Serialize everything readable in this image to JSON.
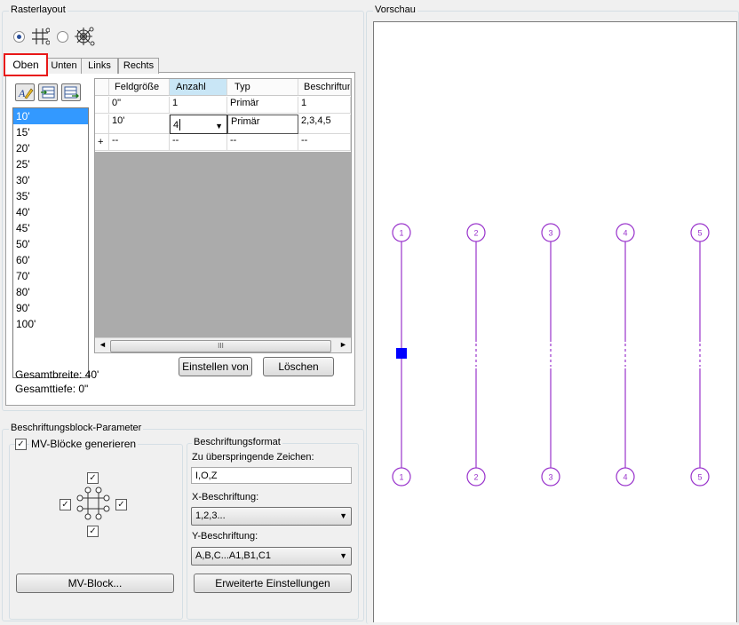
{
  "raster_layout": {
    "group_title": "Rasterlayout",
    "tabs": [
      "Oben",
      "Unten",
      "Links",
      "Rechts"
    ],
    "selected_tab": "Oben",
    "list_items": [
      "10'",
      "15'",
      "20'",
      "25'",
      "30'",
      "35'",
      "40'",
      "45'",
      "50'",
      "60'",
      "70'",
      "80'",
      "90'",
      "100'"
    ],
    "selected_list_item": "10'",
    "grid": {
      "columns": [
        "Feldgröße",
        "Anzahl",
        "Typ",
        "Beschriftun"
      ],
      "rows": [
        {
          "marker": "",
          "feldgroesse": "0\"",
          "anzahl": "1",
          "typ": "Primär",
          "beschriftung": "1"
        },
        {
          "marker": "",
          "feldgroesse": "10'",
          "anzahl": "4",
          "typ": "Primär",
          "beschriftung": "2,3,4,5"
        },
        {
          "marker": "+",
          "feldgroesse": "--",
          "anzahl": "--",
          "typ": "--",
          "beschriftung": "--"
        }
      ],
      "scroll_thumb_label": "III"
    },
    "buttons": {
      "einstellen": "Einstellen von",
      "loeschen": "Löschen"
    },
    "gesamtbreite": "Gesamtbreite: 40'",
    "gesamttiefe": "Gesamttiefe: 0\""
  },
  "beschriftungsblock": {
    "group_title": "Beschriftungsblock-Parameter",
    "mv_checkbox_label": "MV-Blöcke generieren",
    "mv_block_button": "MV-Block...",
    "format_title": "Beschriftungsformat",
    "skip_label": "Zu überspringende Zeichen:",
    "skip_value": "I,O,Z",
    "x_label": "X-Beschriftung:",
    "x_value": "1,2,3...",
    "y_label": "Y-Beschriftung:",
    "y_value": "A,B,C...A1,B1,C1",
    "advanced_button": "Erweiterte Einstellungen"
  },
  "vorschau": {
    "title": "Vorschau",
    "bubble_labels": [
      "1",
      "2",
      "3",
      "4",
      "5"
    ],
    "line_color": "#9933cc"
  },
  "colors": {
    "accent_red": "#e81818",
    "selection_blue": "#3399ff",
    "grip_blue": "#0000ff"
  }
}
